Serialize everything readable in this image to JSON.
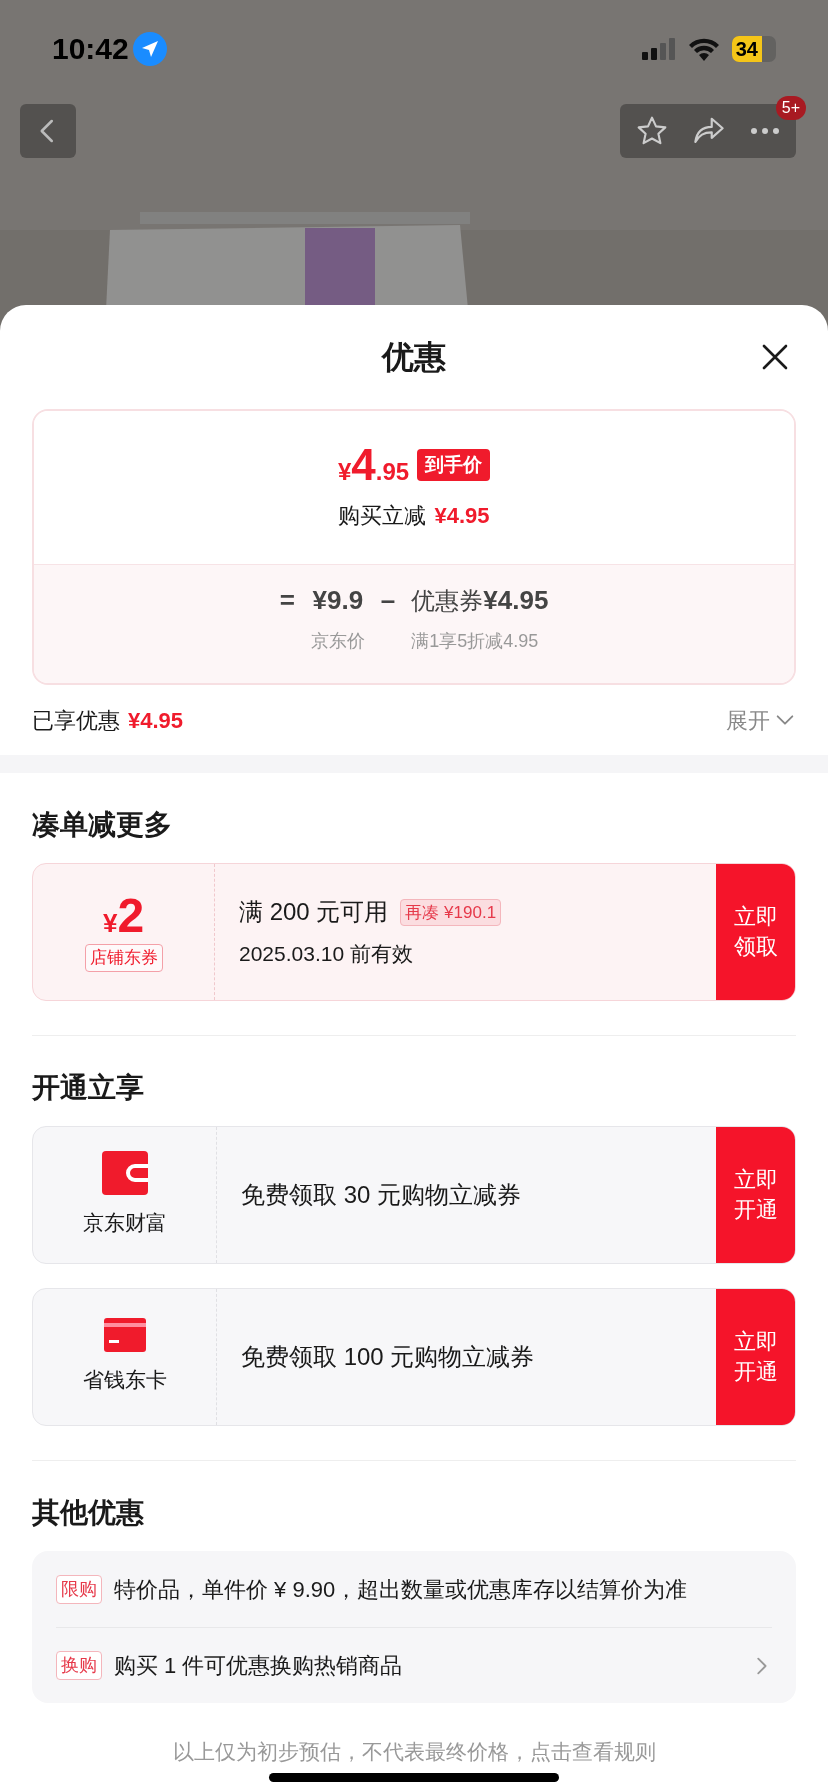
{
  "status_bar": {
    "time": "10:42",
    "battery": "34"
  },
  "nav": {
    "badge": "5+"
  },
  "sheet": {
    "title": "优惠"
  },
  "price_card": {
    "currency": "¥",
    "price_int": "4",
    "price_dec": ".95",
    "price_tag": "到手价",
    "instant_label": "购买立减",
    "instant_amount": "¥4.95",
    "equals": "=",
    "base_price": "¥9.9",
    "minus": "–",
    "coupon_label": "优惠券",
    "coupon_amount": "¥4.95",
    "base_caption": "京东价",
    "coupon_caption": "满1享5折减4.95"
  },
  "summary": {
    "label": "已享优惠",
    "amount": "¥4.95",
    "expand": "展开",
    "expanded": false
  },
  "sections": [
    {
      "title": "凑单减更多",
      "cards": [
        {
          "kind": "coupon",
          "currency": "¥",
          "amount": "2",
          "tag": "店铺东券",
          "condition": "满 200 元可用",
          "hint": "再凑 ¥190.1",
          "validity": "2025.03.10 前有效",
          "action": "立即领取"
        }
      ]
    },
    {
      "title": "开通立享",
      "cards": [
        {
          "kind": "wallet",
          "name": "京东财富",
          "offer": "免费领取 30 元购物立减券",
          "action": "立即开通"
        },
        {
          "kind": "card",
          "name": "省钱东卡",
          "offer": "免费领取 100 元购物立减券",
          "action": "立即开通"
        }
      ]
    }
  ],
  "other": {
    "title": "其他优惠",
    "items": [
      {
        "tag": "限购",
        "text": "特价品，单件价 ¥ 9.90，超出数量或优惠库存以结算价为准",
        "link": false
      },
      {
        "tag": "换购",
        "text": "购买 1 件可优惠换购热销商品",
        "link": true
      }
    ]
  },
  "footer": "以上仅为初步预估，不代表最终价格，点击查看规则"
}
